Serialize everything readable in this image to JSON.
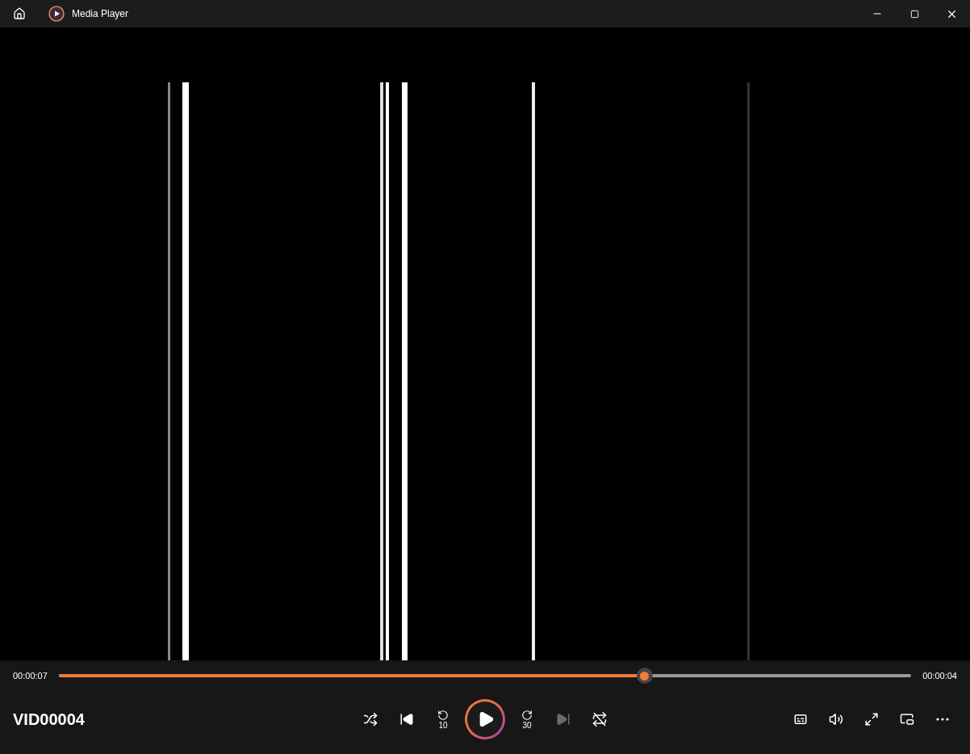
{
  "window": {
    "title": "Media Player"
  },
  "playback": {
    "elapsed": "00:00:07",
    "remaining": "00:00:04",
    "level": 0.687
  },
  "media_title": "VID00004",
  "transport": [
    {
      "kind": "shuffle",
      "disabled": false
    },
    {
      "kind": "previous",
      "disabled": false
    },
    {
      "kind": "skip_back",
      "label": "10",
      "disabled": false
    },
    {
      "kind": "play",
      "disabled": false
    },
    {
      "kind": "skip_forward",
      "label": "30",
      "disabled": false
    },
    {
      "kind": "next",
      "disabled": true
    },
    {
      "kind": "repeat",
      "disabled": false
    }
  ],
  "tools": [
    {
      "kind": "captions"
    },
    {
      "kind": "volume"
    },
    {
      "kind": "fullscreen"
    },
    {
      "kind": "mini_player"
    },
    {
      "kind": "more"
    }
  ]
}
